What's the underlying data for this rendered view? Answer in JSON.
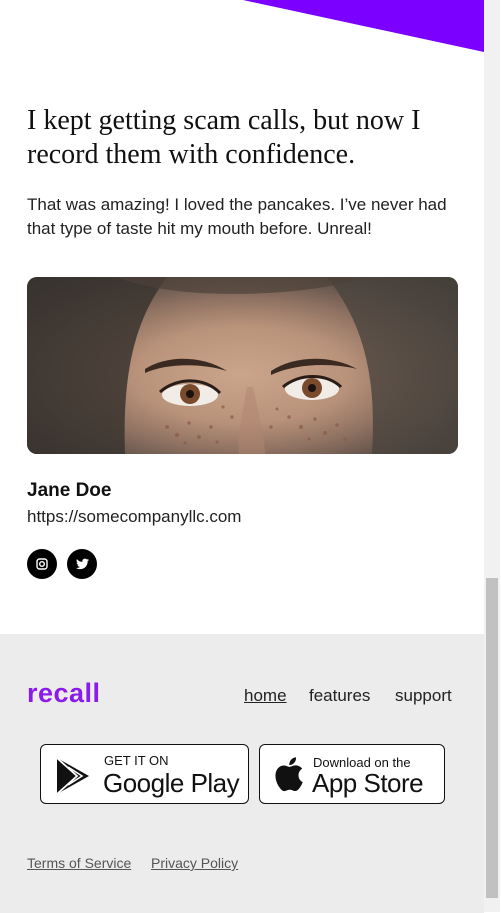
{
  "testimonial": {
    "quote": "I kept getting scam calls, but now I record them with confidence.",
    "body": "That was amazing! I loved the pancakes. I’ve never had that type of taste hit my mouth before. Unreal!",
    "author_name": "Jane Doe",
    "author_url": "https://somecompanyllc.com",
    "photo_icon": "portrait-photo"
  },
  "social": {
    "items": [
      {
        "icon": "instagram-icon"
      },
      {
        "icon": "twitter-icon"
      }
    ]
  },
  "footer": {
    "brand": "recall",
    "nav": {
      "home": "home",
      "features": "features",
      "support": "support"
    },
    "stores": {
      "google_small": "GET IT ON",
      "google_big": "Google Play",
      "apple_small": "Download on the",
      "apple_big": "App Store"
    },
    "legal": {
      "terms": "Terms of Service",
      "privacy": "Privacy Policy"
    }
  },
  "colors": {
    "brand": "#8a1be8",
    "accent": "#7b00ff",
    "footer_bg": "#ececec"
  }
}
